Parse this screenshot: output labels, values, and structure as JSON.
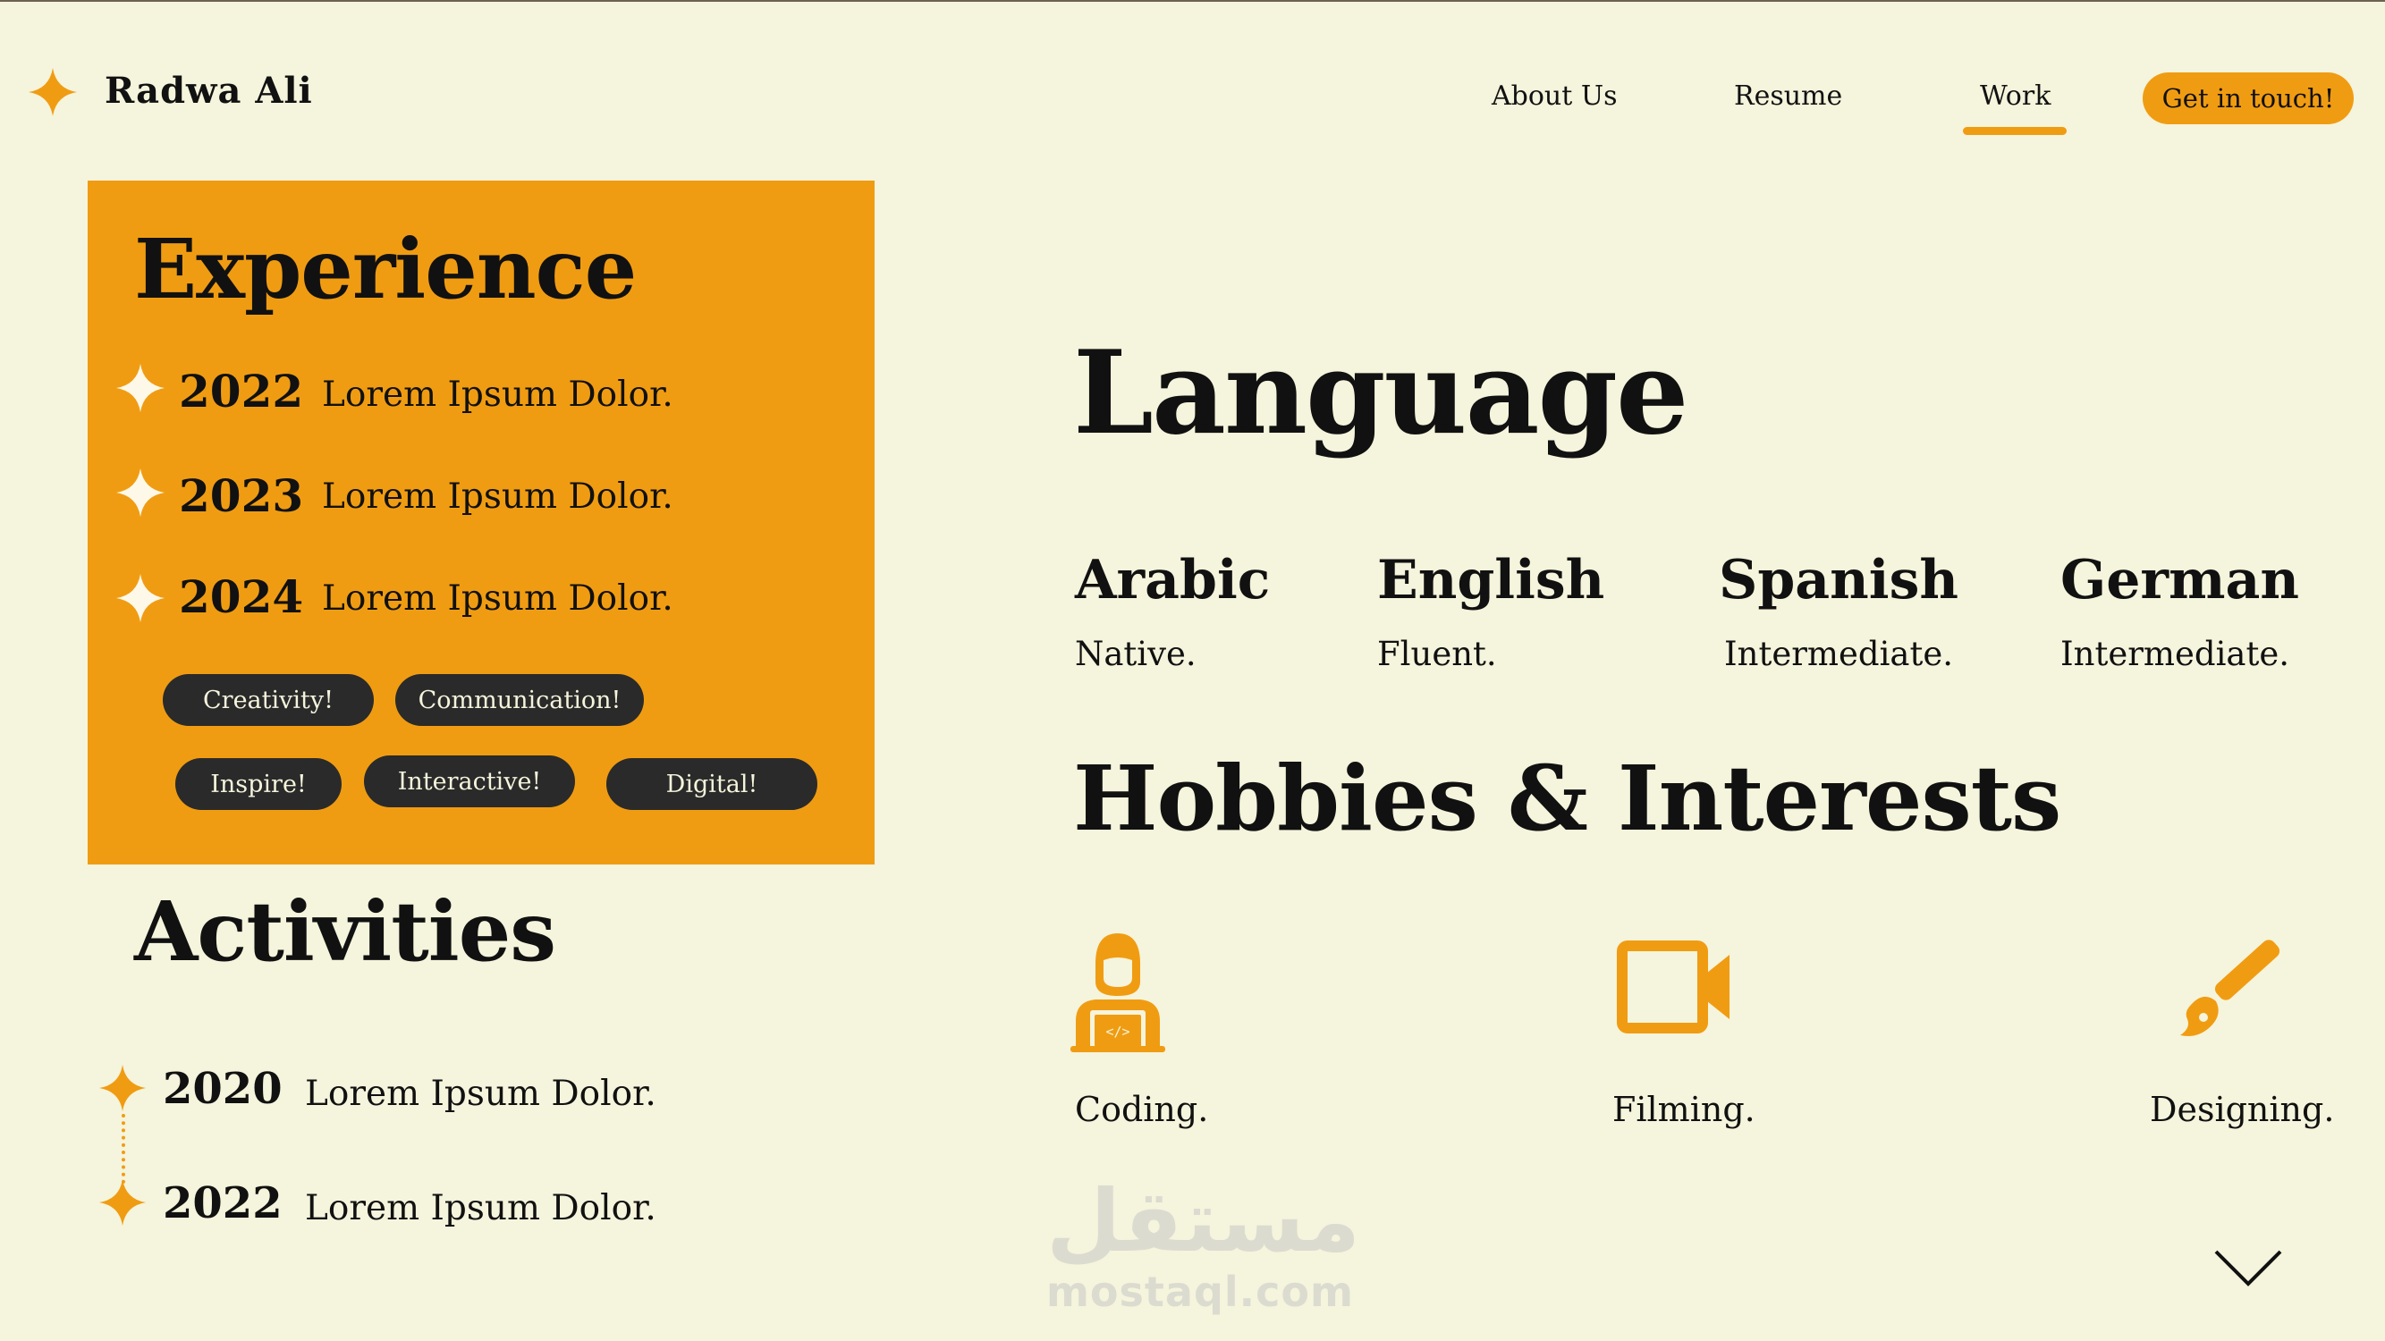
{
  "header": {
    "brand": "Radwa Ali",
    "logo_icon": "four-point-star-icon",
    "nav": [
      {
        "label": "About Us"
      },
      {
        "label": "Resume"
      },
      {
        "label": "Work",
        "active": true
      }
    ],
    "cta_label": "Get in touch!"
  },
  "experience": {
    "title": "Experience",
    "items": [
      {
        "year": "2022",
        "text": "Lorem Ipsum Dolor."
      },
      {
        "year": "2023",
        "text": "Lorem Ipsum Dolor."
      },
      {
        "year": "2024",
        "text": "Lorem Ipsum Dolor."
      }
    ],
    "tags": [
      "Creativity!",
      "Communication!",
      "Inspire!",
      "Interactive!",
      "Digital!"
    ]
  },
  "activities": {
    "title": "Activities",
    "items": [
      {
        "year": "2020",
        "text": "Lorem Ipsum Dolor."
      },
      {
        "year": "2022",
        "text": "Lorem Ipsum Dolor."
      }
    ]
  },
  "language": {
    "title": "Language",
    "items": [
      {
        "name": "Arabic",
        "level": "Native."
      },
      {
        "name": "English",
        "level": "Fluent."
      },
      {
        "name": "Spanish",
        "level": "Intermediate."
      },
      {
        "name": "German",
        "level": "Intermediate."
      }
    ]
  },
  "hobbies": {
    "title": "Hobbies & Interests",
    "items": [
      {
        "label": "Coding.",
        "icon": "coder-laptop-icon"
      },
      {
        "label": "Filming.",
        "icon": "video-camera-icon"
      },
      {
        "label": "Designing.",
        "icon": "paintbrush-icon"
      }
    ]
  },
  "watermark": {
    "arabic": "مستقل",
    "latin": "mostaql.com"
  },
  "colors": {
    "background": "#f5f4dc",
    "accent": "#f09c12",
    "pill": "#2a2a2a",
    "text": "#111111"
  }
}
